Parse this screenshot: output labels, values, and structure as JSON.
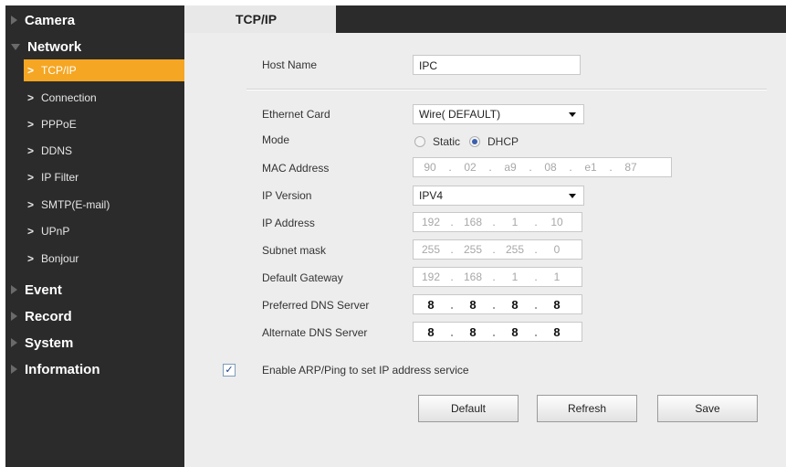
{
  "sidebar": {
    "categories": {
      "camera": "Camera",
      "network": "Network",
      "event": "Event",
      "record": "Record",
      "system": "System",
      "information": "Information"
    },
    "network_items": [
      "TCP/IP",
      "Connection",
      "PPPoE",
      "DDNS",
      "IP Filter",
      "SMTP(E-mail)",
      "UPnP",
      "Bonjour"
    ],
    "active_item": "TCP/IP"
  },
  "tab": {
    "label": "TCP/IP"
  },
  "form": {
    "host_name": {
      "label": "Host Name",
      "value": "IPC"
    },
    "ethernet_card": {
      "label": "Ethernet Card",
      "value": "Wire( DEFAULT)"
    },
    "mode": {
      "label": "Mode",
      "options": [
        "Static",
        "DHCP"
      ],
      "selected": "DHCP"
    },
    "mac_address": {
      "label": "MAC Address",
      "octets": [
        "90",
        "02",
        "a9",
        "08",
        "e1",
        "87"
      ]
    },
    "ip_version": {
      "label": "IP Version",
      "value": "IPV4"
    },
    "ip_address": {
      "label": "IP Address",
      "octets": [
        "192",
        "168",
        "1",
        "10"
      ]
    },
    "subnet_mask": {
      "label": "Subnet mask",
      "octets": [
        "255",
        "255",
        "255",
        "0"
      ]
    },
    "default_gateway": {
      "label": "Default Gateway",
      "octets": [
        "192",
        "168",
        "1",
        "1"
      ]
    },
    "preferred_dns": {
      "label": "Preferred DNS Server",
      "octets": [
        "8",
        "8",
        "8",
        "8"
      ]
    },
    "alternate_dns": {
      "label": "Alternate DNS Server",
      "octets": [
        "8",
        "8",
        "8",
        "8"
      ]
    },
    "arp_ping": {
      "label": "Enable ARP/Ping to set IP address service",
      "checked": true
    }
  },
  "buttons": {
    "default": "Default",
    "refresh": "Refresh",
    "save": "Save"
  },
  "colors": {
    "sidebar_bg": "#2b2b2b",
    "active_item": "#f5a623",
    "main_bg": "#ededed"
  }
}
